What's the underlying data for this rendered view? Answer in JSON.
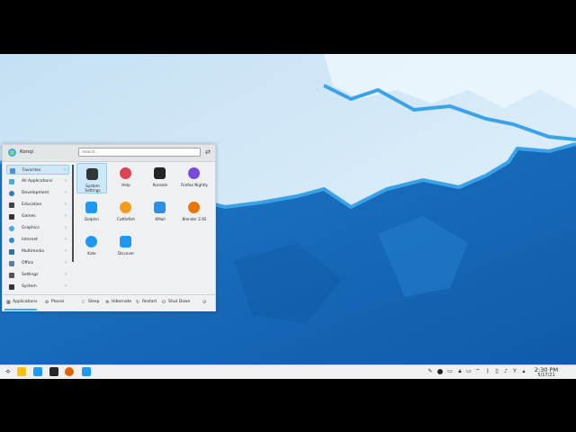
{
  "launcher": {
    "user": "Konqi",
    "search_placeholder": "Search...",
    "categories": [
      {
        "label": "Favorites",
        "icon": "star-icon",
        "color": "#4a90d9",
        "selected": true
      },
      {
        "label": "All Applications",
        "icon": "grid-icon",
        "color": "#3daee9"
      },
      {
        "label": "Development",
        "icon": "code-icon",
        "color": "#2e7cc4"
      },
      {
        "label": "Education",
        "icon": "graduation-icon",
        "color": "#444444"
      },
      {
        "label": "Games",
        "icon": "gamepad-icon",
        "color": "#333333"
      },
      {
        "label": "Graphics",
        "icon": "palette-icon",
        "color": "#3daee9"
      },
      {
        "label": "Internet",
        "icon": "globe-icon",
        "color": "#2a8fd6"
      },
      {
        "label": "Multimedia",
        "icon": "media-icon",
        "color": "#2d6fa8"
      },
      {
        "label": "Office",
        "icon": "briefcase-icon",
        "color": "#5b7ea3"
      },
      {
        "label": "Settings",
        "icon": "settings-icon",
        "color": "#555555"
      },
      {
        "label": "System",
        "icon": "system-icon",
        "color": "#31363b"
      }
    ],
    "apps": [
      {
        "label": "System Settings",
        "icon": "system-settings-icon",
        "color": "#31363b",
        "selected": true
      },
      {
        "label": "Help",
        "icon": "help-icon",
        "color": "#da4453"
      },
      {
        "label": "Konsole",
        "icon": "konsole-icon",
        "color": "#232629"
      },
      {
        "label": "Firefox Nightly",
        "icon": "firefox-nightly-icon",
        "color": "#7a4bd8"
      },
      {
        "label": "Dolphin",
        "icon": "dolphin-icon",
        "color": "#1d99f3"
      },
      {
        "label": "Cuttlefish",
        "icon": "cuttlefish-icon",
        "color": "#f39c1f"
      },
      {
        "label": "KMail",
        "icon": "kmail-icon",
        "color": "#2d8fe0"
      },
      {
        "label": "Blender 2.92",
        "icon": "blender-icon",
        "color": "#ea7600"
      },
      {
        "label": "Kate",
        "icon": "kate-icon",
        "color": "#1d99f3"
      },
      {
        "label": "Discover",
        "icon": "discover-icon",
        "color": "#1d99f3"
      }
    ],
    "footer": {
      "applications": "Applications",
      "places": "Places",
      "sleep": "Sleep",
      "hibernate": "Hibernate",
      "restart": "Restart",
      "shutdown": "Shut Down"
    }
  },
  "taskbar": {
    "time": "2:30 PM",
    "date": "5/17/21",
    "apps": [
      {
        "icon": "launcher-icon",
        "color": "#232629"
      },
      {
        "icon": "notes-icon",
        "color": "#f5c211"
      },
      {
        "icon": "dolphin-icon",
        "color": "#1d99f3"
      },
      {
        "icon": "konsole-icon",
        "color": "#232629"
      },
      {
        "icon": "firefox-icon",
        "color": "#e66000"
      },
      {
        "icon": "discover-icon",
        "color": "#1d99f3"
      }
    ]
  },
  "colors": {
    "accent": "#3daee9",
    "wall_dark": "#1a6fc4",
    "wall_light": "#d4eaf8"
  }
}
